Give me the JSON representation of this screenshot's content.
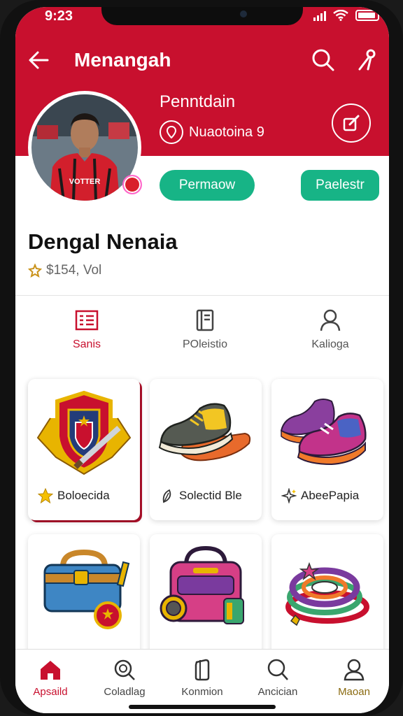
{
  "status_bar": {
    "time": "9:23"
  },
  "header": {
    "title": "Menangah",
    "subtitle": "Penntdain",
    "location": "Nuaotoina 9"
  },
  "actions": {
    "primary_label": "Permaow",
    "secondary_label": "Paelestr"
  },
  "profile": {
    "name": "Dengal Nenaia",
    "stats": "$154, Vol",
    "jersey_text": "VOTTER"
  },
  "tabs": [
    {
      "label": "Sanis",
      "icon": "list-icon",
      "active": true
    },
    {
      "label": "POleistio",
      "icon": "book-icon",
      "active": false
    },
    {
      "label": "Kalioga",
      "icon": "user-icon",
      "active": false
    }
  ],
  "cards": [
    {
      "label": "Boloecida",
      "icon": "star-icon",
      "art": "shield-crest"
    },
    {
      "label": "Solectid Ble",
      "icon": "leaf-icon",
      "art": "sneaker-dark"
    },
    {
      "label": "AbeePapia",
      "icon": "sparkle-icon",
      "art": "sneaker-purple"
    },
    {
      "label": "",
      "icon": "",
      "art": "blue-bag"
    },
    {
      "label": "",
      "icon": "",
      "art": "pink-bag"
    },
    {
      "label": "",
      "icon": "",
      "art": "bracelets"
    }
  ],
  "bottom_nav": [
    {
      "label": "Apsaild",
      "icon": "home-icon",
      "active": true
    },
    {
      "label": "Coladlag",
      "icon": "search-icon",
      "active": false
    },
    {
      "label": "Konmion",
      "icon": "phone-icon",
      "active": false
    },
    {
      "label": "Ancician",
      "icon": "magnifier-icon",
      "active": false
    },
    {
      "label": "Maoan",
      "icon": "person-icon",
      "active": false
    }
  ],
  "colors": {
    "brand": "#c8102e",
    "accent": "#17b486",
    "gold": "#e8b400"
  }
}
